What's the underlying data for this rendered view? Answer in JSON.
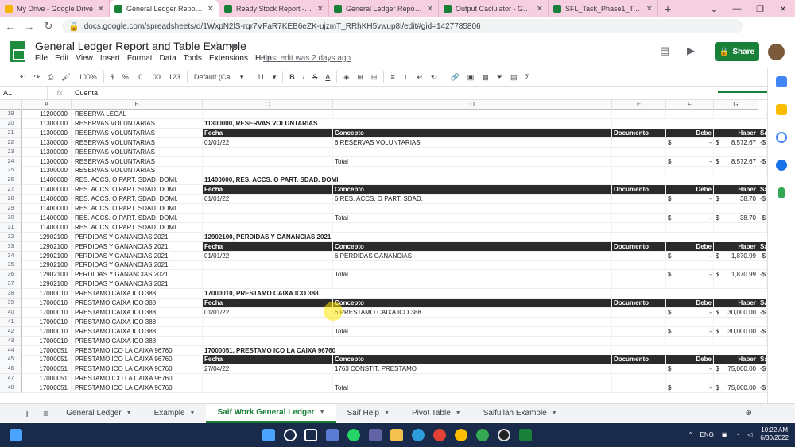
{
  "browser_tabs": [
    {
      "title": "My Drive - Google Drive",
      "color": "#f4b400"
    },
    {
      "title": "General Ledger Report and Ta",
      "color": "#188038",
      "active": true
    },
    {
      "title": "Ready Stock Report - Google",
      "color": "#188038"
    },
    {
      "title": "General Ledger Report and S",
      "color": "#188038"
    },
    {
      "title": "Output Caclulator - Google S",
      "color": "#188038"
    },
    {
      "title": "SFL_Task_Phase1_TestFile_U",
      "color": "#188038"
    }
  ],
  "address": "docs.google.com/spreadsheets/d/1WxpN2lS-rqr7VFaR7KEB6eZK-ujzmT_RRhKH5vwup8l/edit#gid=1427785806",
  "doc": {
    "title": "General Ledger Report and Table Example",
    "last_edit": "Last edit was 2 days ago",
    "share_label": "Share"
  },
  "menu": [
    "File",
    "Edit",
    "View",
    "Insert",
    "Format",
    "Data",
    "Tools",
    "Extensions",
    "Help"
  ],
  "toolbar": {
    "zoom": "100%",
    "currency": "$",
    "percent": "%",
    "dec_less": ".0",
    "dec_more": ".00",
    "format": "123",
    "font": "Default (Ca...",
    "size": "11"
  },
  "formula_bar": {
    "cell": "A1",
    "fx": "fx",
    "value": "Cuenta"
  },
  "columns": [
    "A",
    "B",
    "C",
    "D",
    "E",
    "F",
    "G"
  ],
  "rows": [
    {
      "n": "19",
      "a": "11200000",
      "b": "RESERVA LEGAL"
    },
    {
      "n": "20",
      "a": "11300000",
      "b": "RESERVAS VOLUNTARIAS",
      "title": "11300000, RESERVAS VOLUNTARIAS"
    },
    {
      "n": "21",
      "a": "11300000",
      "b": "RESERVAS VOLUNTARIAS",
      "hdr": true
    },
    {
      "n": "22",
      "a": "11300000",
      "b": "RESERVAS VOLUNTARIAS",
      "fecha": "01/01/22",
      "concepto": "6 RESERVAS VOLUNTARIAS",
      "debe_s": "$",
      "debe_v": "-",
      "haber_s": "$",
      "haber_v": "8,572.67",
      "sa": "-$"
    },
    {
      "n": "23",
      "a": "11300000",
      "b": "RESERVAS VOLUNTARIAS"
    },
    {
      "n": "24",
      "a": "11300000",
      "b": "RESERVAS VOLUNTARIAS",
      "concepto": "Total",
      "debe_s": "$",
      "debe_v": "-",
      "haber_s": "$",
      "haber_v": "8,572.67",
      "sa": "-$"
    },
    {
      "n": "25",
      "a": "11300000",
      "b": "RESERVAS VOLUNTARIAS"
    },
    {
      "n": "26",
      "a": "11400000",
      "b": "RES. ACCS. O PART. SDAD. DOMI.",
      "title": "11400000, RES. ACCS. O PART. SDAD. DOMI."
    },
    {
      "n": "27",
      "a": "11400000",
      "b": "RES. ACCS. O PART. SDAD. DOMI.",
      "hdr": true
    },
    {
      "n": "28",
      "a": "11400000",
      "b": "RES. ACCS. O PART. SDAD. DOMI.",
      "fecha": "01/01/22",
      "concepto": "6 RES. ACCS. O PART. SDAD.",
      "debe_s": "$",
      "debe_v": "-",
      "haber_s": "$",
      "haber_v": "38.70",
      "sa": "-$"
    },
    {
      "n": "29",
      "a": "11400000",
      "b": "RES. ACCS. O PART. SDAD. DOMI."
    },
    {
      "n": "30",
      "a": "11400000",
      "b": "RES. ACCS. O PART. SDAD. DOMI.",
      "concepto": "Total",
      "debe_s": "$",
      "debe_v": "-",
      "haber_s": "$",
      "haber_v": "38.70",
      "sa": "-$"
    },
    {
      "n": "31",
      "a": "11400000",
      "b": "RES. ACCS. O PART. SDAD. DOMI."
    },
    {
      "n": "32",
      "a": "12902100",
      "b": "PERDIDAS Y GANANCIAS 2021",
      "title": "12902100, PERDIDAS Y GANANCIAS 2021"
    },
    {
      "n": "33",
      "a": "12902100",
      "b": "PERDIDAS Y GANANCIAS 2021",
      "hdr": true
    },
    {
      "n": "34",
      "a": "12902100",
      "b": "PERDIDAS Y GANANCIAS 2021",
      "fecha": "01/01/22",
      "concepto": "6 PERDIDAS GANANCIAS",
      "debe_s": "$",
      "debe_v": "-",
      "haber_s": "$",
      "haber_v": "1,870.99",
      "sa": "-$"
    },
    {
      "n": "35",
      "a": "12902100",
      "b": "PERDIDAS Y GANANCIAS 2021"
    },
    {
      "n": "36",
      "a": "12902100",
      "b": "PERDIDAS Y GANANCIAS 2021",
      "concepto": "Total",
      "debe_s": "$",
      "debe_v": "-",
      "haber_s": "$",
      "haber_v": "1,870.99",
      "sa": "-$"
    },
    {
      "n": "37",
      "a": "12902100",
      "b": "PERDIDAS Y GANANCIAS 2021"
    },
    {
      "n": "38",
      "a": "17000010",
      "b": "PRESTAMO CAIXA ICO 388",
      "title": "17000010, PRESTAMO CAIXA ICO 388"
    },
    {
      "n": "39",
      "a": "17000010",
      "b": "PRESTAMO CAIXA ICO 388",
      "hdr": true
    },
    {
      "n": "40",
      "a": "17000010",
      "b": "PRESTAMO CAIXA ICO 388",
      "fecha": "01/01/22",
      "concepto": "6 PRESTAMO CAIXA ICO 388",
      "debe_s": "$",
      "debe_v": "-",
      "haber_s": "$",
      "haber_v": "30,000.00",
      "sa": "-$"
    },
    {
      "n": "41",
      "a": "17000010",
      "b": "PRESTAMO CAIXA ICO 388"
    },
    {
      "n": "42",
      "a": "17000010",
      "b": "PRESTAMO CAIXA ICO 388",
      "concepto": "Total",
      "debe_s": "$",
      "debe_v": "-",
      "haber_s": "$",
      "haber_v": "30,000.00",
      "sa": "-$"
    },
    {
      "n": "43",
      "a": "17000010",
      "b": "PRESTAMO CAIXA ICO 388"
    },
    {
      "n": "44",
      "a": "17000051",
      "b": "PRESTAMO ICO LA CAIXA 96760",
      "title": "17000051, PRESTAMO ICO LA CAIXA 96760"
    },
    {
      "n": "45",
      "a": "17000051",
      "b": "PRESTAMO ICO LA CAIXA 96760",
      "hdr": true
    },
    {
      "n": "46",
      "a": "17000051",
      "b": "PRESTAMO ICO LA CAIXA 96760",
      "fecha": "27/04/22",
      "concepto": "1763 CONSTIT. PRESTAMO",
      "debe_s": "$",
      "debe_v": "-",
      "haber_s": "$",
      "haber_v": "75,000.00",
      "sa": "-$"
    },
    {
      "n": "47",
      "a": "17000051",
      "b": "PRESTAMO ICO LA CAIXA 96760"
    },
    {
      "n": "48",
      "a": "17000051",
      "b": "PRESTAMO ICO LA CAIXA 96760",
      "concepto": "Total",
      "debe_s": "$",
      "debe_v": "-",
      "haber_s": "$",
      "haber_v": "75,000.00",
      "sa": "-$"
    }
  ],
  "table_header": {
    "fecha": "Fecha",
    "concepto": "Concepto",
    "documento": "Documento",
    "debe": "Debe",
    "haber": "Haber",
    "sa": "Sa"
  },
  "sheet_tabs": [
    {
      "label": "General Ledger"
    },
    {
      "label": "Example"
    },
    {
      "label": "Saif Work General Ledger",
      "active": true
    },
    {
      "label": "Saif Help"
    },
    {
      "label": "Pivot Table"
    },
    {
      "label": "Saifullah Example"
    }
  ],
  "taskbar": {
    "lang": "ENG",
    "time": "10:22 AM",
    "date": "6/30/2022"
  }
}
